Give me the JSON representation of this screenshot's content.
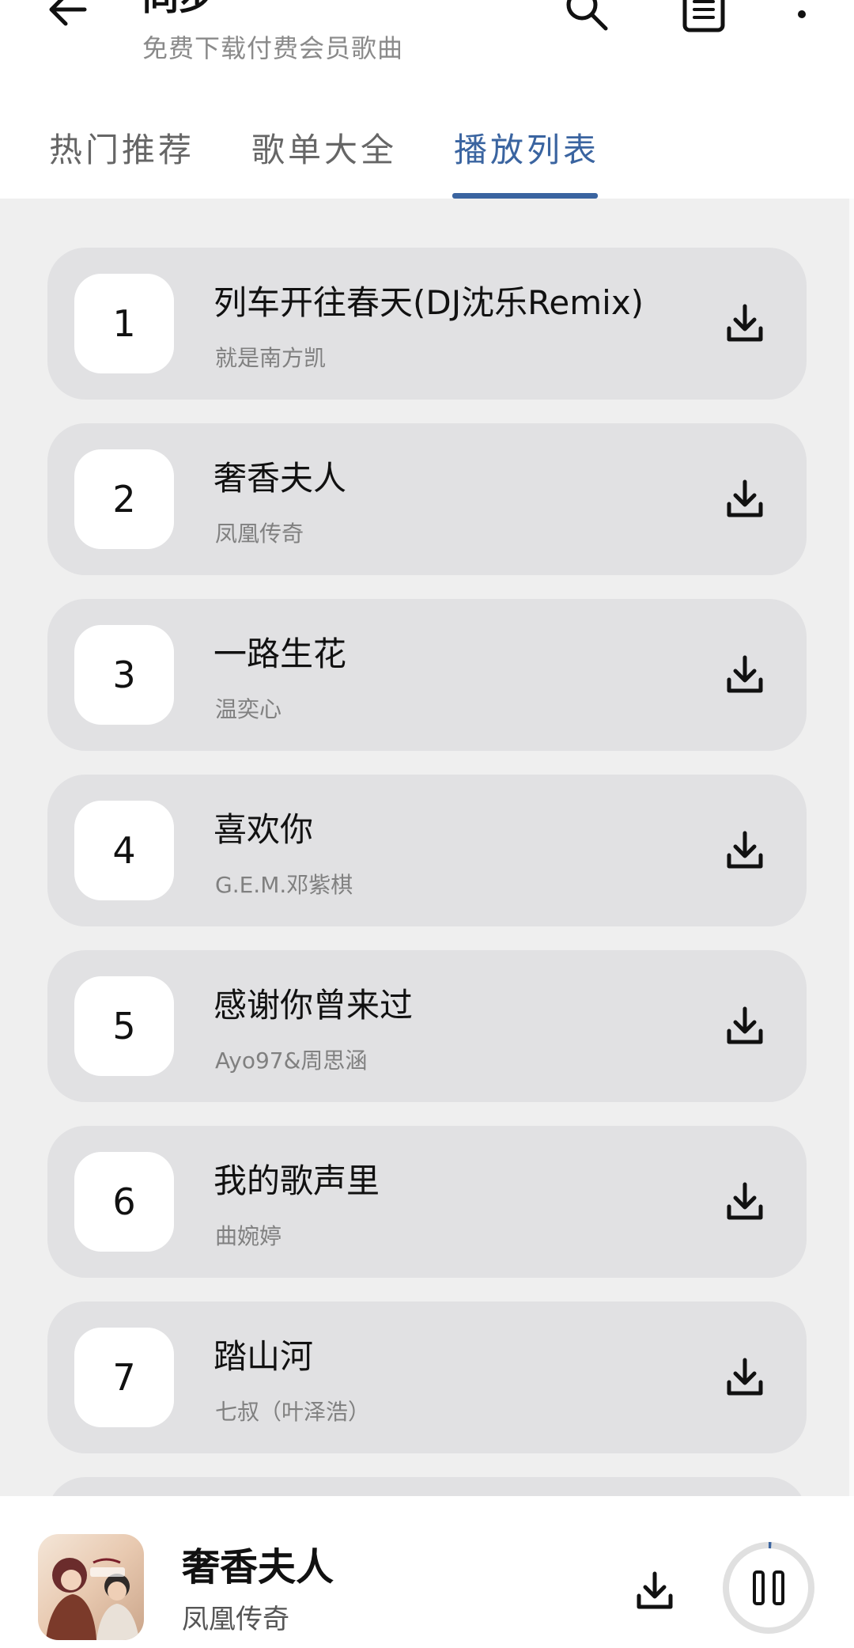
{
  "header": {
    "title": "同步",
    "subtitle": "免费下载付费会员歌曲"
  },
  "tabs": [
    {
      "label": "热门推荐",
      "active": false
    },
    {
      "label": "歌单大全",
      "active": false
    },
    {
      "label": "播放列表",
      "active": true
    }
  ],
  "songs": [
    {
      "index": "1",
      "title": "列车开往春天(DJ沈乐Remix)",
      "artist": "就是南方凯"
    },
    {
      "index": "2",
      "title": "奢香夫人",
      "artist": "凤凰传奇"
    },
    {
      "index": "3",
      "title": "一路生花",
      "artist": "温奕心"
    },
    {
      "index": "4",
      "title": "喜欢你",
      "artist": "G.E.M.邓紫棋"
    },
    {
      "index": "5",
      "title": "感谢你曾来过",
      "artist": "Ayo97&周思涵"
    },
    {
      "index": "6",
      "title": "我的歌声里",
      "artist": "曲婉婷"
    },
    {
      "index": "7",
      "title": "踏山河",
      "artist": "七叔（叶泽浩）"
    }
  ],
  "player": {
    "title": "奢香夫人",
    "artist": "凤凰传奇",
    "progress": 0.01
  },
  "colors": {
    "accent": "#3a64a0",
    "card": "#e1e1e3",
    "list_bg": "#efefef"
  },
  "icons": {
    "back": "arrow-left",
    "search": "magnifier",
    "playlist": "list-document",
    "more": "vertical-dots",
    "download": "download-tray",
    "pause": "pause-bars"
  }
}
